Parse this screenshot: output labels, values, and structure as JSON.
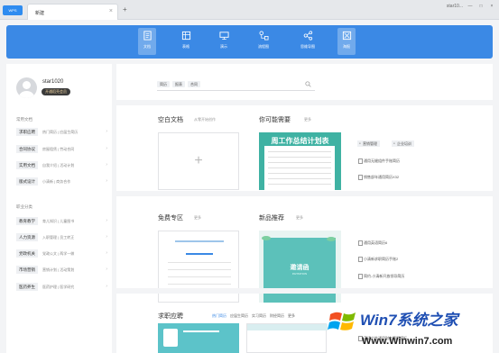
{
  "tabbar": {
    "logo_label": "WPS",
    "tab_label": "新建",
    "new_tab": "+",
    "user": "star10...",
    "window_controls": [
      "—",
      "□",
      "×"
    ]
  },
  "toolbar": {
    "color": "#3b89e5",
    "items": [
      {
        "label": "文档",
        "icon": "document-icon",
        "active": true
      },
      {
        "label": "表格",
        "icon": "table-icon",
        "active": false
      },
      {
        "label": "演示",
        "icon": "presentation-icon",
        "active": false
      },
      {
        "label": "流程图",
        "icon": "flowchart-icon",
        "active": false
      },
      {
        "label": "思维导图",
        "icon": "mindmap-icon",
        "active": false
      },
      {
        "label": "海报",
        "icon": "poster-icon",
        "active": true
      }
    ]
  },
  "sidebar": {
    "username": "star1020",
    "vip_button": "开通稻壳会员",
    "common_title": "常用文档",
    "common": [
      {
        "tag": "求职应聘",
        "sub": "热门简历 | 应届生简历"
      },
      {
        "tag": "合同协议",
        "sub": "房屋租赁 | 劳动合同"
      },
      {
        "tag": "实用文档",
        "sub": "自我介绍 | 活动计划"
      },
      {
        "tag": "版式设计",
        "sub": "小清新 | 商务合作"
      }
    ],
    "work_title": "职业分类",
    "work": [
      {
        "tag": "教育教学",
        "sub": "育儿知识 | 儿童图书"
      },
      {
        "tag": "人力资源",
        "sub": "入职管理 | 员工转正"
      },
      {
        "tag": "党政机关",
        "sub": "党政公文 | 两学一做"
      },
      {
        "tag": "市场营销",
        "sub": "营销计划 | 活动策划"
      },
      {
        "tag": "医药养生",
        "sub": "医药护理 | 医学研究"
      }
    ]
  },
  "main": {
    "search_tags": [
      "简历",
      "报表",
      "合同"
    ],
    "blank_section": {
      "title": "空白文档",
      "sub": "从零开始创作"
    },
    "maybe_section": {
      "title": "你可能需要",
      "more": "更多"
    },
    "summary_title": "周工作总结计划表",
    "hot_chips": [
      "营销管理",
      "企业培训"
    ],
    "maybe_links": [
      "通用无缝组件手账简历",
      "销售部年通用简历X32"
    ],
    "free_section": {
      "title": "免费专区",
      "more": "更多"
    },
    "new_section": {
      "title": "新品推荐",
      "more": "更多"
    },
    "invite_title": "邀请函",
    "invite_sub": "INVITATION",
    "new_links": [
      "通用英语简历6",
      "小清新求职简历手账2",
      "简约-小清新开放领导简历"
    ],
    "job_section": {
      "title": "求职应聘"
    },
    "job_tabs": [
      "热门简历",
      "应届生简历",
      "实习简历",
      "财经简历",
      "更多"
    ],
    "job_tabs_active": 0,
    "job_link": "英语个性通用财务简历模板"
  },
  "watermark": {
    "brand": "Win7系统之家",
    "url": "Www.Winwin7.com"
  }
}
